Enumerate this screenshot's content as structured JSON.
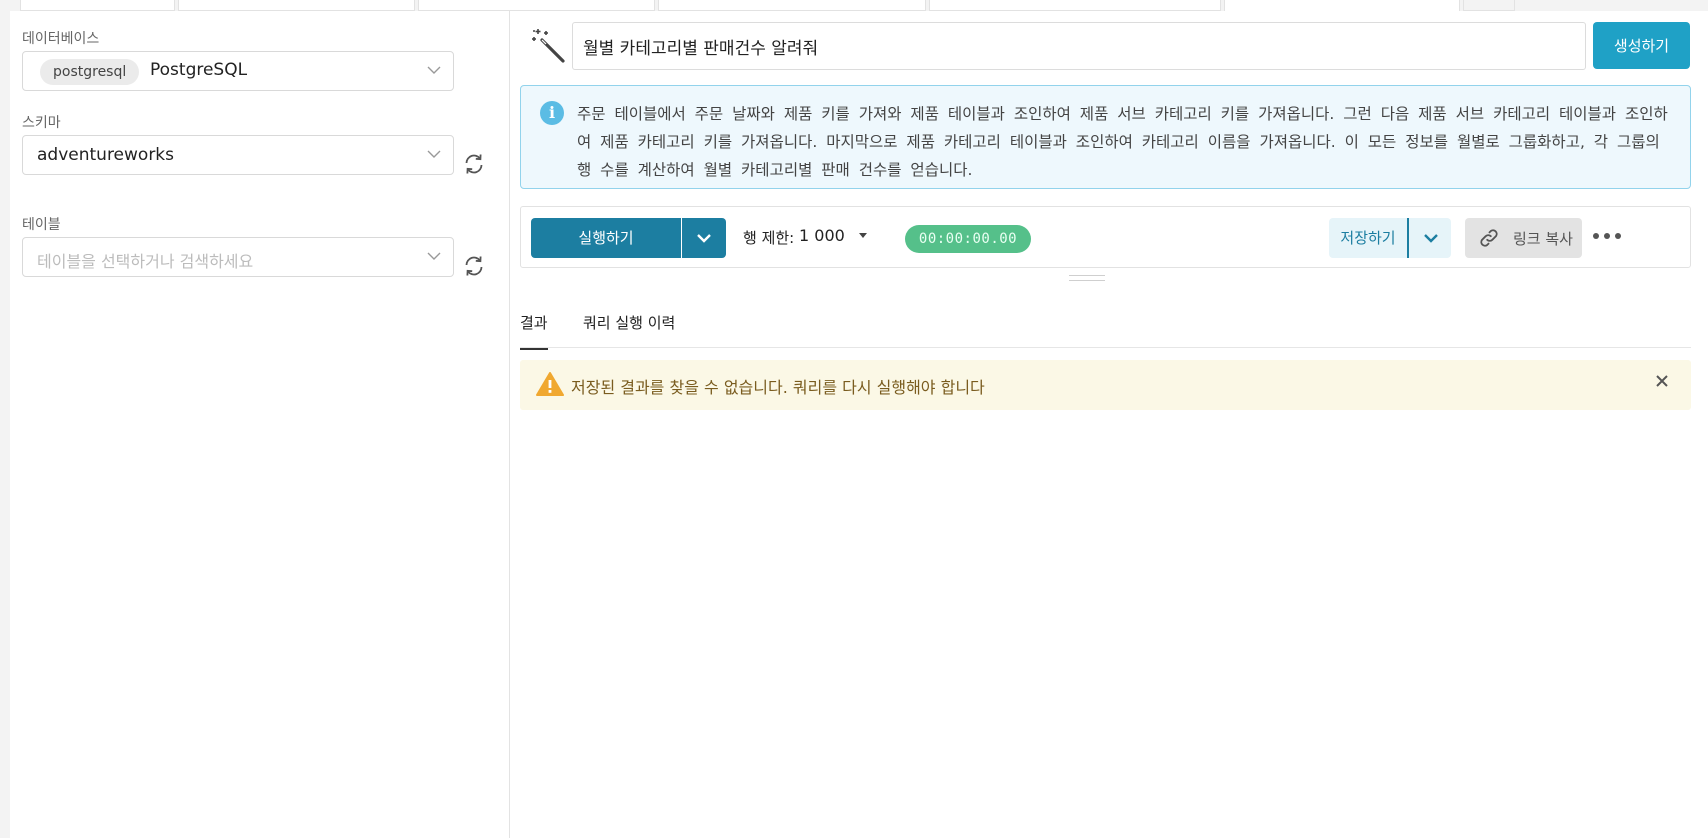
{
  "sidebar": {
    "database_label": "데이터베이스",
    "database_badge": "postgresql",
    "database_value": "PostgreSQL",
    "schema_label": "스키마",
    "schema_value": "adventureworks",
    "table_label": "테이블",
    "table_placeholder": "테이블을 선택하거나 검색하세요"
  },
  "prompt": {
    "value": "월별 카테고리별 판매건수 알려줘",
    "generate_label": "생성하기"
  },
  "info": {
    "text": "주문 테이블에서 주문 날짜와 제품 키를 가져와 제품 테이블과 조인하여 제품 서브 카테고리 키를 가져옵니다. 그런 다음 제품 서브 카테고리 테이블과 조인하여 제품 카테고리 키를 가져옵니다. 마지막으로 제품 카테고리 테이블과 조인하여 카테고리 이름을 가져옵니다. 이 모든 정보를 월별로 그룹화하고, 각 그룹의 행 수를 계산하여 월별 카테고리별 판매 건수를 얻습니다."
  },
  "toolbar": {
    "run_label": "실행하기",
    "limit_label": "행 제한:",
    "limit_value": "1 000",
    "timer": "00:00:00.00",
    "save_label": "저장하기",
    "copy_link_label": "링크 복사"
  },
  "tabs": [
    {
      "label": "결과"
    },
    {
      "label": "쿼리 실행 이력"
    }
  ],
  "warning": {
    "text": "저장된 결과를 찾을 수 없습니다. 쿼리를 다시 실행해야 합니다"
  },
  "colors": {
    "primary": "#1c7ea1",
    "generate": "#1fa1c6",
    "timer": "#55c08a",
    "info_bg": "#eef8fd",
    "warning_bg": "#fbf8e6",
    "warning_icon": "#f0a830"
  }
}
